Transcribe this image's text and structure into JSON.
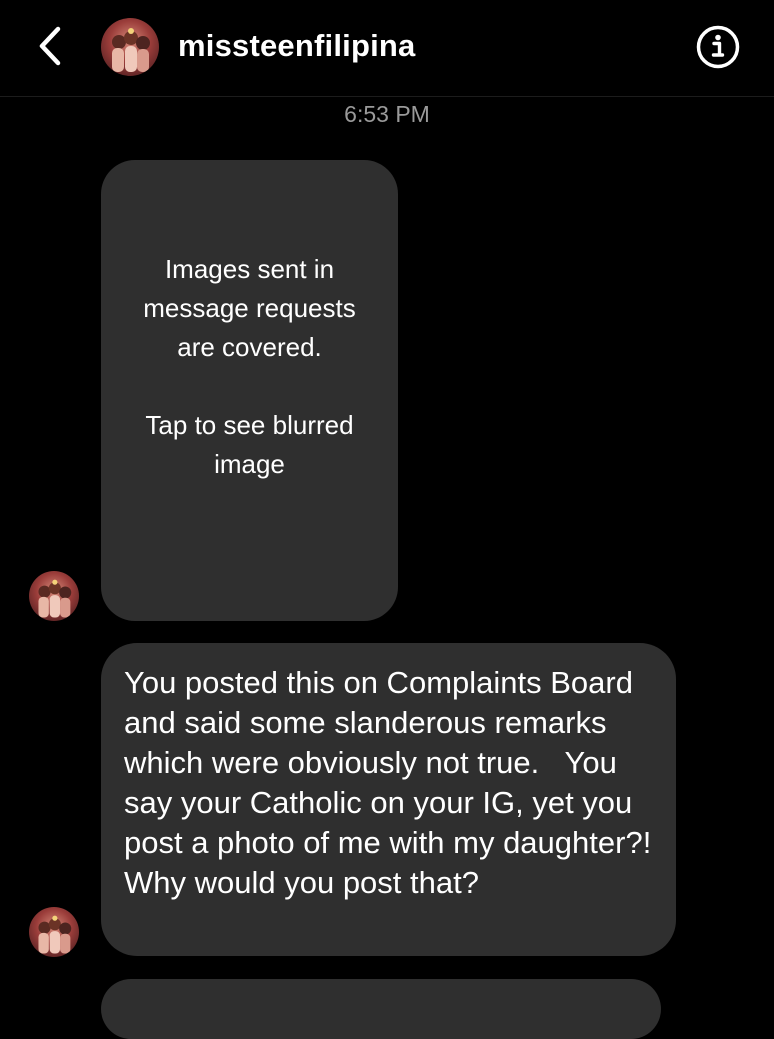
{
  "header": {
    "username": "missteenfilipina"
  },
  "thread": {
    "timestamp": "6:53 PM",
    "image_notice": {
      "text": "Images sent in message requests are covered.",
      "action": "Tap to see blurred image"
    },
    "message": {
      "text": "You posted this on Complaints Board and said some slanderous remarks which were obviously not true.   You say your Catholic on your IG, yet you post a photo of me with my daughter?! Why would you post that?"
    }
  },
  "icons": {
    "back": "chevron-left-icon",
    "info": "info-circle-icon"
  },
  "colors": {
    "background": "#000000",
    "bubble": "#2f2f2f",
    "timestamp": "#9a9a9a",
    "text": "#ffffff"
  }
}
